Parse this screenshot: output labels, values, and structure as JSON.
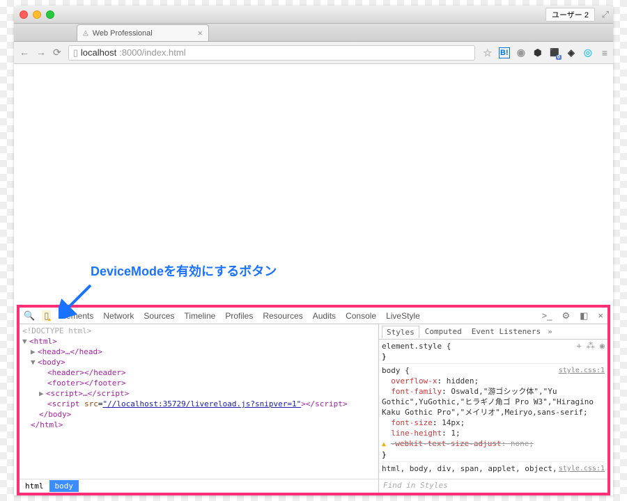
{
  "window": {
    "user_label": "ユーザー 2"
  },
  "tab": {
    "title": "Web Professional"
  },
  "url": {
    "host": "localhost",
    "rest": ":8000/index.html"
  },
  "annotation": {
    "text": "DeviceModeを有効にするボタン"
  },
  "devtools": {
    "tabs": [
      "Elements",
      "Network",
      "Sources",
      "Timeline",
      "Profiles",
      "Resources",
      "Audits",
      "Console",
      "LiveStyle"
    ],
    "dom": {
      "doctype": "<!DOCTYPE html>",
      "html_open": "<html>",
      "head": "<head>…</head>",
      "body_open": "<body>",
      "header": "<header></header>",
      "footer": "<footer></footer>",
      "script1": "<script>…</script>",
      "script2_pre": "<script ",
      "script2_attr": "src",
      "script2_val": "\"//localhost:35729/livereload.js?snipver=1\"",
      "script2_post": "></script>",
      "body_close": "</body>",
      "html_close": "</html>"
    },
    "breadcrumb": [
      "html",
      "body"
    ],
    "styles": {
      "tabs": [
        "Styles",
        "Computed",
        "Event Listeners"
      ],
      "element_style": "element.style {",
      "rule_sel": "body {",
      "rule_src": "style.css:1",
      "props": {
        "overflow_x": {
          "k": "overflow-x",
          "v": "hidden;"
        },
        "font_family": {
          "k": "font-family",
          "v": "Oswald,\"游ゴシック体\",\"Yu Gothic\",YuGothic,\"ヒラギノ角ゴ Pro W3\",\"Hiragino Kaku Gothic Pro\",\"メイリオ\",Meiryo,sans-serif;"
        },
        "font_size": {
          "k": "font-size",
          "v": "14px;"
        },
        "line_height": {
          "k": "line-height",
          "v": "1;"
        },
        "webkit": {
          "k": "-webkit-text-size-adjust",
          "v": "none;"
        }
      },
      "footer_rule": "html, body, div, span, applet, object,",
      "footer_src": "style.css:1",
      "find": "Find in Styles"
    }
  }
}
